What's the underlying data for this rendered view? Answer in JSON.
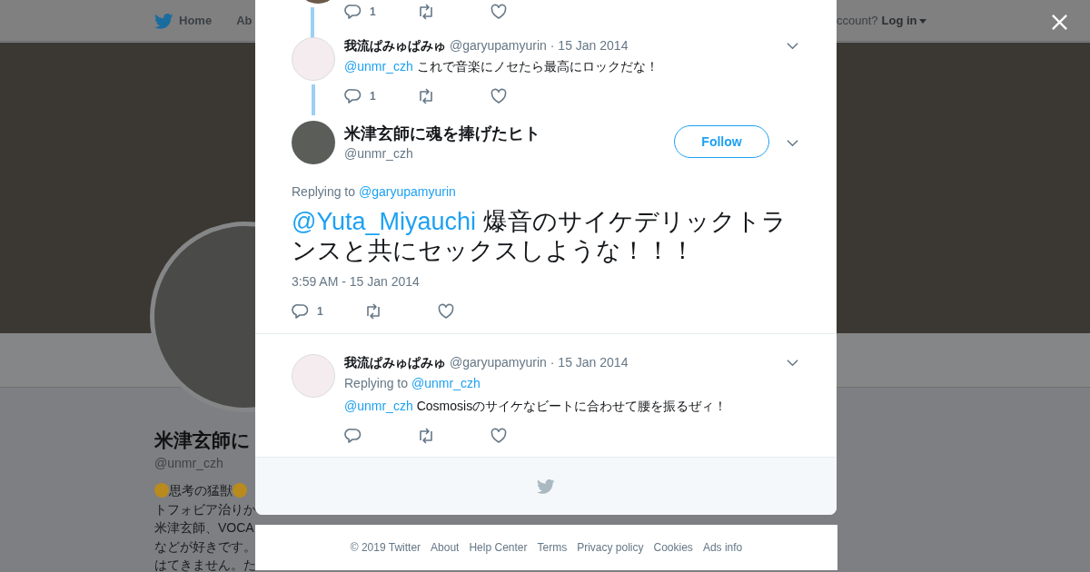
{
  "background_page": {
    "nav": {
      "items": [
        {
          "label": "Home"
        },
        {
          "label": "Ab"
        }
      ],
      "account_prompt": "ccount?",
      "login": "Log in"
    },
    "profile": {
      "name": "米津玄師に",
      "handle": "@unmr_czh",
      "bio_lines": [
        "思考の猛獣",
        "トフォビア治りか",
        "米津玄師、VOCA",
        "などが好きです。",
        "はてきません。た"
      ]
    }
  },
  "conversation": {
    "previous_tweet": {
      "reply_count": "1"
    },
    "tweets": [
      {
        "kind": "reply",
        "thread_line": true,
        "name": "我流ぱみゅぱみゅ",
        "handle": "@garyupamyurin",
        "date": "· 15 Jan 2014",
        "mention": "@unmr_czh",
        "text": "これで音楽にノセたら最高にロックだな！",
        "reply_count": "1"
      },
      {
        "kind": "main",
        "name": "米津玄師に魂を捧げたヒト",
        "handle": "@unmr_czh",
        "follow": "Follow",
        "replying_label": "Replying to",
        "replying_to": "@garyupamyurin",
        "mention": "@Yuta_Miyauchi",
        "text": "爆音のサイケデリックトランスと共にセックスしような！！！",
        "timestamp": "3:59 AM - 15 Jan 2014",
        "reply_count": "1"
      },
      {
        "kind": "reply",
        "thread_line": false,
        "name": "我流ぱみゅぱみゅ",
        "handle": "@garyupamyurin",
        "date": "· 15 Jan 2014",
        "replying_label": "Replying to",
        "replying_to": "@unmr_czh",
        "mention": "@unmr_czh",
        "text": "Cosmosisのサイケなビートに合わせて腰を振るぜィ！"
      }
    ]
  },
  "footer_links": [
    "© 2019 Twitter",
    "About",
    "Help Center",
    "Terms",
    "Privacy policy",
    "Cookies",
    "Ads info"
  ]
}
